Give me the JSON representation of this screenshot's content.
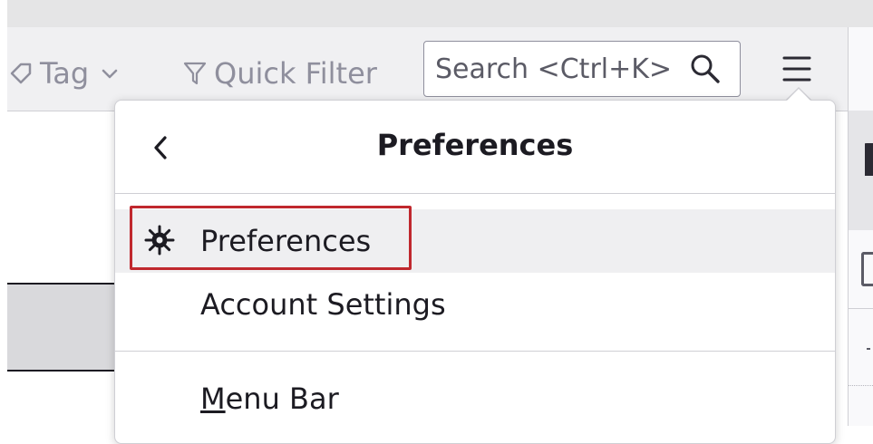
{
  "toolbar": {
    "tag_label": "Tag",
    "quick_filter_label": "Quick Filter",
    "search_placeholder": "Search <Ctrl+K>"
  },
  "popup": {
    "title": "Preferences",
    "items": [
      {
        "label": "Preferences",
        "icon": "gear-icon",
        "highlighted": true
      },
      {
        "label": "Account Settings"
      },
      {
        "accesskey": "M",
        "label_rest": "enu Bar"
      }
    ]
  },
  "colors": {
    "highlight_border": "#c0282e",
    "toolbar_bg": "#f0f0f2",
    "hover_bg": "#efeff1"
  }
}
